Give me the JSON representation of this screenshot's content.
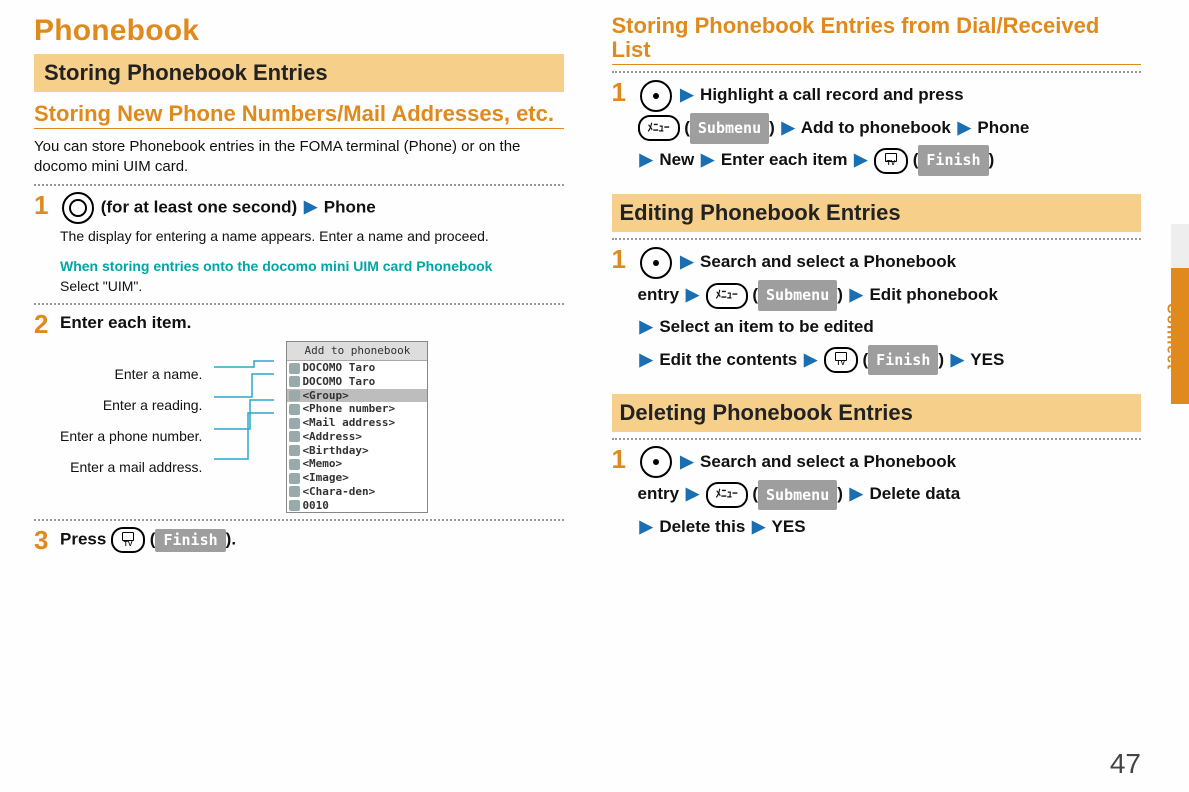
{
  "page_number": "47",
  "side_tab": "Connect",
  "left": {
    "chapter": "Phonebook",
    "section": "Storing Phonebook Entries",
    "subsection": "Storing New Phone Numbers/Mail Addresses, etc.",
    "intro": "You can store Phonebook entries in the FOMA terminal (Phone) or on the docomo mini UIM card.",
    "step1": {
      "num": "1",
      "action_suffix": " (for at least one second)",
      "target": "Phone",
      "note": "The display for entering a name appears. Enter a name and proceed.",
      "uim_title": "When storing entries onto the docomo mini UIM card Phonebook",
      "uim_body": "Select \"UIM\"."
    },
    "step2": {
      "num": "2",
      "title": "Enter each item.",
      "callouts": {
        "name": "Enter a name.",
        "reading": "Enter a reading.",
        "phone": "Enter a phone number.",
        "mail": "Enter a mail address."
      },
      "screen": {
        "title": "Add to phonebook",
        "rows": {
          "name": "DOCOMO Taro",
          "reading": "DOCOMO Taro",
          "group": "<Group>",
          "phone": "<Phone number>",
          "mail": "<Mail address>",
          "address": "<Address>",
          "birthday": "<Birthday>",
          "memo": "<Memo>",
          "image": "<Image>",
          "chara": "<Chara-den>",
          "id": "0010"
        }
      }
    },
    "step3": {
      "num": "3",
      "prefix": "Press ",
      "finish_label": "Finish",
      "suffix": "."
    }
  },
  "right": {
    "sectionA": {
      "title": "Storing Phonebook Entries from Dial/Received List",
      "step_num": "1",
      "line1_a": "Highlight a call record and press",
      "submenu": "Submenu",
      "line2_a": "Add to phonebook",
      "line2_b": "Phone",
      "line3_a": "New",
      "line3_b": "Enter each item",
      "finish": "Finish"
    },
    "sectionB": {
      "band": "Editing Phonebook Entries",
      "step_num": "1",
      "l1": "Search and select a Phonebook",
      "l2a": "entry",
      "submenu": "Submenu",
      "l2b": "Edit phonebook",
      "l3": "Select an item to be edited",
      "l4": "Edit the contents",
      "finish": "Finish",
      "yes": "YES"
    },
    "sectionC": {
      "band": "Deleting Phonebook Entries",
      "step_num": "1",
      "l1": "Search and select a Phonebook",
      "l2a": "entry",
      "submenu": "Submenu",
      "l2b": "Delete data",
      "l3a": "Delete this",
      "yes": "YES"
    }
  },
  "icons": {
    "menu_text": "ﾒﾆｭｰ"
  }
}
